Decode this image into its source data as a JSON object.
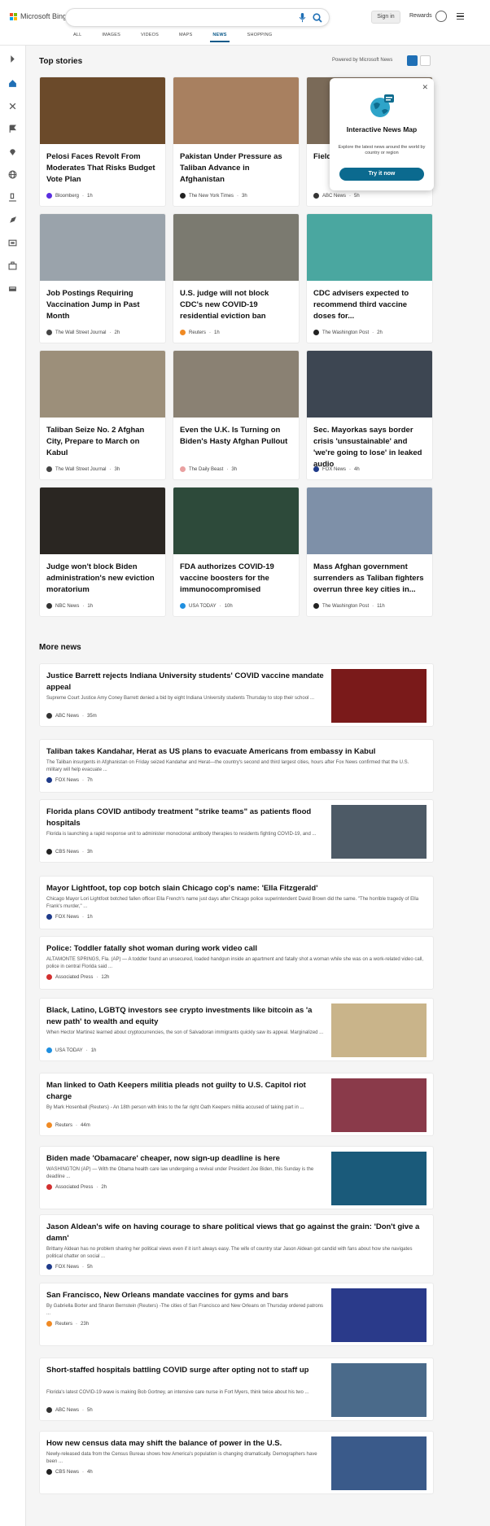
{
  "header": {
    "brand": "Microsoft Bing",
    "search_value": "",
    "signin_label": "Sign in",
    "rewards_label": "Rewards",
    "logo_colors": [
      "#f25022",
      "#7fba00",
      "#00a4ef",
      "#ffb900"
    ]
  },
  "nav": {
    "tabs": [
      {
        "label": "ALL",
        "active": false
      },
      {
        "label": "IMAGES",
        "active": false
      },
      {
        "label": "VIDEOS",
        "active": false
      },
      {
        "label": "MAPS",
        "active": false
      },
      {
        "label": "NEWS",
        "active": true
      },
      {
        "label": "SHOPPING",
        "active": false
      }
    ]
  },
  "sidebar": {
    "icons": [
      "expand-icon",
      "home-icon",
      "sparkle-icon",
      "flag-icon",
      "location-pin-icon",
      "globe-icon",
      "microscope-icon",
      "rocket-icon",
      "tv-icon",
      "briefcase-icon",
      "money-icon"
    ]
  },
  "top_stories": {
    "heading": "Top stories",
    "powered_by": "Powered by Microsoft News",
    "cards": [
      {
        "title": "Pelosi Faces Revolt From Moderates That Risks Budget Vote Plan",
        "source": "Bloomberg",
        "time": "1h",
        "source_color": "#5a2ee0",
        "image_color": "#6b4a2a"
      },
      {
        "title": "Pakistan Under Pressure as Taliban Advance in Afghanistan",
        "source": "The New York Times",
        "time": "3h",
        "source_color": "#222222",
        "image_color": "#a88060"
      },
      {
        "title": "Field garag COVI",
        "source": "ABC News",
        "time": "5h",
        "source_color": "#333333",
        "image_color": "#7a6a58"
      },
      {
        "title": "Job Postings Requiring Vaccination Jump in Past Month",
        "source": "The Wall Street Journal",
        "time": "2h",
        "source_color": "#444444",
        "image_color": "#9aa3ab"
      },
      {
        "title": "U.S. judge will not block CDC's new COVID-19 residential eviction ban",
        "source": "Reuters",
        "time": "1h",
        "source_color": "#f08a24",
        "image_color": "#7b7a70"
      },
      {
        "title": "CDC advisers expected to recommend third vaccine doses for...",
        "source": "The Washington Post",
        "time": "2h",
        "source_color": "#222222",
        "image_color": "#4aa7a0"
      },
      {
        "title": "Taliban Seize No. 2 Afghan City, Prepare to March on Kabul",
        "source": "The Wall Street Journal",
        "time": "3h",
        "source_color": "#444444",
        "image_color": "#9c8f7a"
      },
      {
        "title": "Even the U.K. Is Turning on Biden's Hasty Afghan Pullout",
        "source": "The Daily Beast",
        "time": "3h",
        "source_color": "#e9a0a0",
        "image_color": "#8a8173"
      },
      {
        "title": "Sec. Mayorkas says border crisis 'unsustainable' and 'we're going to lose' in leaked audio",
        "source": "FOX News",
        "time": "4h",
        "source_color": "#1f3b8a",
        "image_color": "#3d4652"
      },
      {
        "title": "Judge won't block Biden administration's new eviction moratorium",
        "source": "NBC News",
        "time": "1h",
        "source_color": "#333333",
        "image_color": "#2a2622"
      },
      {
        "title": "FDA authorizes COVID-19 vaccine boosters for the immunocompromised",
        "source": "USA TODAY",
        "time": "10h",
        "source_color": "#1f8fe0",
        "image_color": "#2d4a3a"
      },
      {
        "title": "Mass Afghan government surrenders as Taliban fighters overrun three key cities in...",
        "source": "The Washington Post",
        "time": "11h",
        "source_color": "#222222",
        "image_color": "#7e90a8"
      }
    ]
  },
  "popup": {
    "title": "Interactive News Map",
    "description": "Explore the latest news around the world by country or region",
    "button_label": "Try it now",
    "close_label": "✕"
  },
  "more_news": {
    "heading": "More news",
    "items": [
      {
        "title": "Justice Barrett rejects Indiana University students' COVID vaccine mandate appeal",
        "desc": "Supreme Court Justice Amy Coney Barrett denied a bid by eight Indiana University students Thursday to stop their school ...",
        "source": "ABC News",
        "time": "35m",
        "source_color": "#333333",
        "image_color": "#7a1a1a",
        "has_image": true
      },
      {
        "title": "Taliban takes Kandahar, Herat as US plans to evacuate Americans from embassy in Kabul",
        "desc": "The Taliban insurgents in Afghanistan on Friday seized Kandahar and Herat—the country's second and third largest cities, hours after Fox News confirmed that the U.S. military will help evacuate ...",
        "source": "FOX News",
        "time": "7h",
        "source_color": "#1f3b8a",
        "image_color": "",
        "has_image": false
      },
      {
        "title": "Florida plans COVID antibody treatment \"strike teams\" as patients flood hospitals",
        "desc": "Florida is launching a rapid response unit to administer monoclonal antibody therapies to residents fighting COVID-19, and ...",
        "source": "CBS News",
        "time": "3h",
        "source_color": "#222222",
        "image_color": "#4d5a66",
        "has_image": true
      },
      {
        "title": "Mayor Lightfoot, top cop botch slain Chicago cop's name: 'Ella Fitzgerald'",
        "desc": "Chicago Mayor Lori Lightfoot botched fallen officer Ella French's name just days after Chicago police superintendent David Brown did the same. \"The horrible tragedy of Ella Frank's murder,\" ...",
        "source": "FOX News",
        "time": "1h",
        "source_color": "#1f3b8a",
        "image_color": "",
        "has_image": false
      },
      {
        "title": "Police: Toddler fatally shot woman during work video call",
        "desc": "ALTAMONTE SPRINGS, Fla. (AP) — A toddler found an unsecured, loaded handgun inside an apartment and fatally shot a woman while she was on a work-related video call, police in central Florida said ...",
        "source": "Associated Press",
        "time": "12h",
        "source_color": "#d23030",
        "image_color": "",
        "has_image": false
      },
      {
        "title": "Black, Latino, LGBTQ investors see crypto investments like bitcoin as 'a new path' to wealth and equity",
        "desc": "When Hector Martinez learned about cryptocurrencies, the son of Salvadoran immigrants quickly saw its appeal. Marginalized ...",
        "source": "USA TODAY",
        "time": "1h",
        "source_color": "#1f8fe0",
        "image_color": "#c9b48a",
        "has_image": true
      },
      {
        "title": "Man linked to Oath Keepers militia pleads not guilty to U.S. Capitol riot charge",
        "desc": "By Mark Hosenball (Reuters) - An 18th person with links to the far right Oath Keepers militia accused of taking part in ...",
        "source": "Reuters",
        "time": "44m",
        "source_color": "#f08a24",
        "image_color": "#8a3a4a",
        "has_image": true
      },
      {
        "title": "Biden made 'Obamacare' cheaper, now sign-up deadline is here",
        "desc": "WASHINGTON (AP) — With the Obama health care law undergoing a revival under President Joe Biden, this Sunday is the deadline ...",
        "source": "Associated Press",
        "time": "2h",
        "source_color": "#d23030",
        "image_color": "#1a5a7a",
        "has_image": true
      },
      {
        "title": "Jason Aldean's wife on having courage to share political views that go against the grain: 'Don't give a damn'",
        "desc": "Brittany Aldean has no problem sharing her political views even if it isn't always easy. The wife of country star Jason Aldean got candid with fans about how she navigates political chatter on social ...",
        "source": "FOX News",
        "time": "5h",
        "source_color": "#1f3b8a",
        "image_color": "",
        "has_image": false
      },
      {
        "title": "San Francisco, New Orleans mandate vaccines for gyms and bars",
        "desc": "By Gabriella Borter and Sharon Bernstein (Reuters) -The cities of San Francisco and New Orleans on Thursday ordered patrons ...",
        "source": "Reuters",
        "time": "23h",
        "source_color": "#f08a24",
        "image_color": "#2a3a8a",
        "has_image": true
      },
      {
        "title": "Short-staffed hospitals battling COVID surge after opting not to staff up",
        "desc": "Florida's latest COVID-19 wave is making Bob Gortney, an intensive care nurse in Fort Myers, think twice about his two ...",
        "source": "ABC News",
        "time": "5h",
        "source_color": "#333333",
        "image_color": "#4a6a8a",
        "has_image": true
      },
      {
        "title": "How new census data may shift the balance of power in the U.S.",
        "desc": "Newly-released data from the Census Bureau shows how America's population is changing dramatically. Demographers have been ...",
        "source": "CBS News",
        "time": "4h",
        "source_color": "#222222",
        "image_color": "#3a5a8a",
        "has_image": true
      }
    ]
  }
}
